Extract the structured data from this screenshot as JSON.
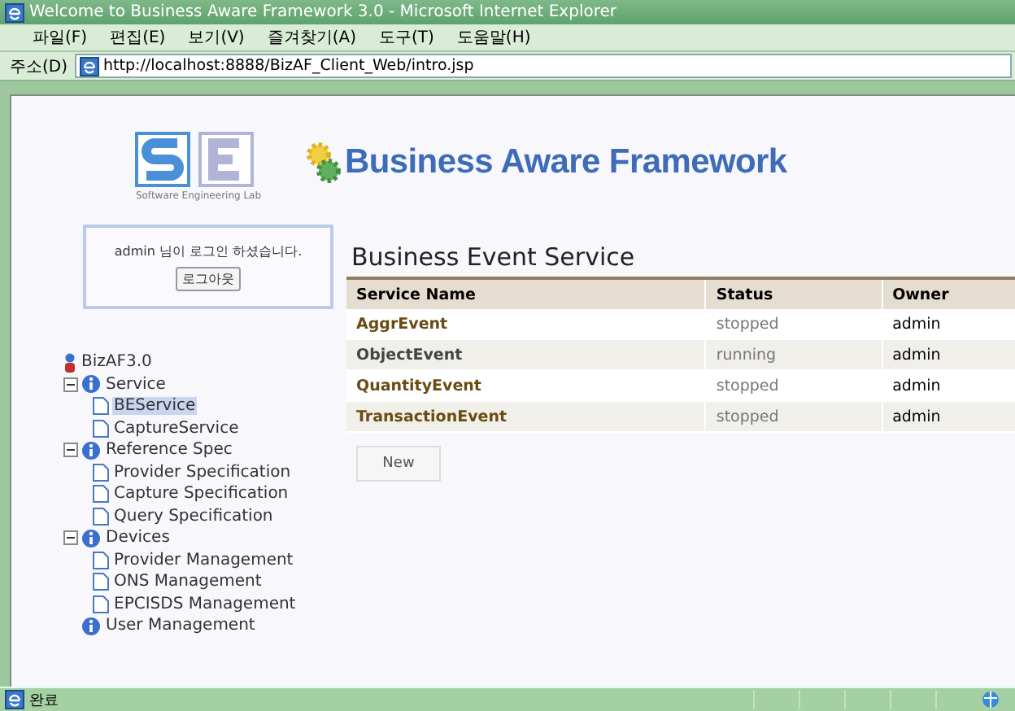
{
  "window": {
    "title": "Welcome to Business Aware Framework 3.0 - Microsoft Internet Explorer"
  },
  "menu": [
    "파일(F)",
    "편집(E)",
    "보기(V)",
    "즐겨찾기(A)",
    "도구(T)",
    "도움말(H)"
  ],
  "address": {
    "label": "주소(D)",
    "value": "http://localhost:8888/BizAF_Client_Web/intro.jsp"
  },
  "logo": {
    "caption": "Software Engineering Lab",
    "title": "Business Aware Framework"
  },
  "login": {
    "message": "admin 님이 로그인 하셨습니다.",
    "button": "로그아웃"
  },
  "tree": {
    "label": "BizAF3.0",
    "children": [
      {
        "kind": "group",
        "label": "Service",
        "expanded": true,
        "selected": false,
        "children": [
          {
            "kind": "page",
            "label": "BEService",
            "selected": true
          },
          {
            "kind": "page",
            "label": "CaptureService",
            "selected": false
          }
        ]
      },
      {
        "kind": "group",
        "label": "Reference Spec",
        "expanded": true,
        "selected": false,
        "children": [
          {
            "kind": "page",
            "label": "Provider Specification",
            "selected": false
          },
          {
            "kind": "page",
            "label": "Capture Specification",
            "selected": false
          },
          {
            "kind": "page",
            "label": "Query Specification",
            "selected": false
          }
        ]
      },
      {
        "kind": "group",
        "label": "Devices",
        "expanded": true,
        "selected": false,
        "children": [
          {
            "kind": "page",
            "label": "Provider Management",
            "selected": false
          },
          {
            "kind": "page",
            "label": "ONS Management",
            "selected": false
          },
          {
            "kind": "page",
            "label": "EPCISDS Management",
            "selected": false
          }
        ]
      },
      {
        "kind": "group",
        "label": "User Management",
        "selected": false
      }
    ]
  },
  "page_title": "Business Event Service",
  "table": {
    "columns": [
      "Service Name",
      "Status",
      "Owner"
    ],
    "rows": [
      {
        "name": "AggrEvent",
        "status": "stopped",
        "owner": "admin",
        "selected": false
      },
      {
        "name": "ObjectEvent",
        "status": "running",
        "owner": "admin",
        "selected": true
      },
      {
        "name": "QuantityEvent",
        "status": "stopped",
        "owner": "admin",
        "selected": false
      },
      {
        "name": "TransactionEvent",
        "status": "stopped",
        "owner": "admin",
        "selected": false
      }
    ]
  },
  "new_button": "New",
  "status_bar": {
    "text": "완료"
  }
}
